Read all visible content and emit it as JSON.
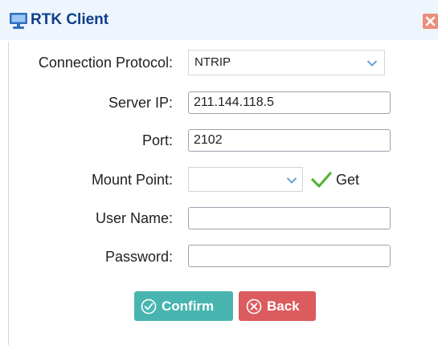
{
  "window": {
    "title": "RTK Client",
    "title_icon": "monitor-icon",
    "close_icon": "close-icon"
  },
  "form": {
    "protocol": {
      "label": "Connection Protocol:",
      "value": "NTRIP"
    },
    "server_ip": {
      "label": "Server IP:",
      "value": "211.144.118.5"
    },
    "port": {
      "label": "Port:",
      "value": "2102"
    },
    "mount_point": {
      "label": "Mount Point:",
      "value": "",
      "get_label": "Get",
      "get_icon": "checkmark-icon"
    },
    "username": {
      "label": "User Name:",
      "value": ""
    },
    "password": {
      "label": "Password:",
      "value": ""
    }
  },
  "buttons": {
    "confirm": {
      "label": "Confirm",
      "icon": "check-circle-icon",
      "color": "#48b5b0"
    },
    "back": {
      "label": "Back",
      "icon": "x-circle-icon",
      "color": "#db5b5f"
    }
  },
  "colors": {
    "title_text": "#0f3f8c",
    "title_bar_bg": "#eef5fd",
    "close_button_bg": "#e98f7b",
    "get_check": "#55b336"
  }
}
